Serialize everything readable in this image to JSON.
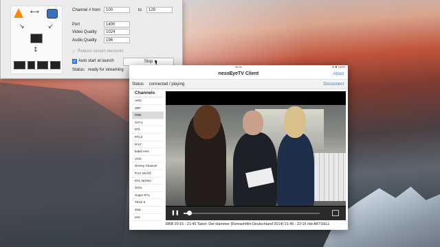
{
  "panel": {
    "channel_from_label": "Channel # from",
    "channel_from_value": "100",
    "to_label": "to",
    "channel_to_value": "129",
    "port_label": "Port",
    "port_value": "1400",
    "video_quality_label": "Video Quality",
    "video_quality_value": "1024",
    "audio_quality_label": "Audio Quality",
    "audio_quality_value": "196",
    "reduce_label": "Reduce stream elements",
    "reduce_check": "✓",
    "autostart_label": "Auto start at launch",
    "autostart_check": "✓",
    "stop_button": "Stop",
    "status_label": "Status:",
    "status_value": "ready for streaming",
    "diagram_arrows": {
      "horizontal": "⟷",
      "diag_left": "↘",
      "diag_right": "↙",
      "vertical": "↕"
    }
  },
  "client": {
    "statusbar_time": "09:41",
    "statusbar_right": "⊕ ✱ 100%",
    "title": "nessEyeTV Client",
    "about": "About",
    "status_label": "Status",
    "status_value": "connected / playing",
    "disconnect": "Disconnect",
    "channels_header": "Channels",
    "channels": [
      "ARD",
      "ZDF",
      "RBB",
      "SAT.1",
      "RTL",
      "RTL2",
      "Pro7",
      "kabel eins",
      "VOX",
      "Disney Channel",
      "Pro7 MAXX",
      "RTL NITRO",
      "SIXX",
      "Super RTL",
      "TELE 5",
      "3sat",
      "arte"
    ],
    "selected_channel": "RBB",
    "video_progress": 0.04,
    "program_caption": "RBB 20:15 - 21:45 Tatort: Der Hammer (Fernsehfilm Deutschland 2014)  21:45 - 22:15 rbb AKTUELL"
  },
  "colors": {
    "accent": "#2f7de1",
    "checkbox_on": "#3b82f6"
  }
}
